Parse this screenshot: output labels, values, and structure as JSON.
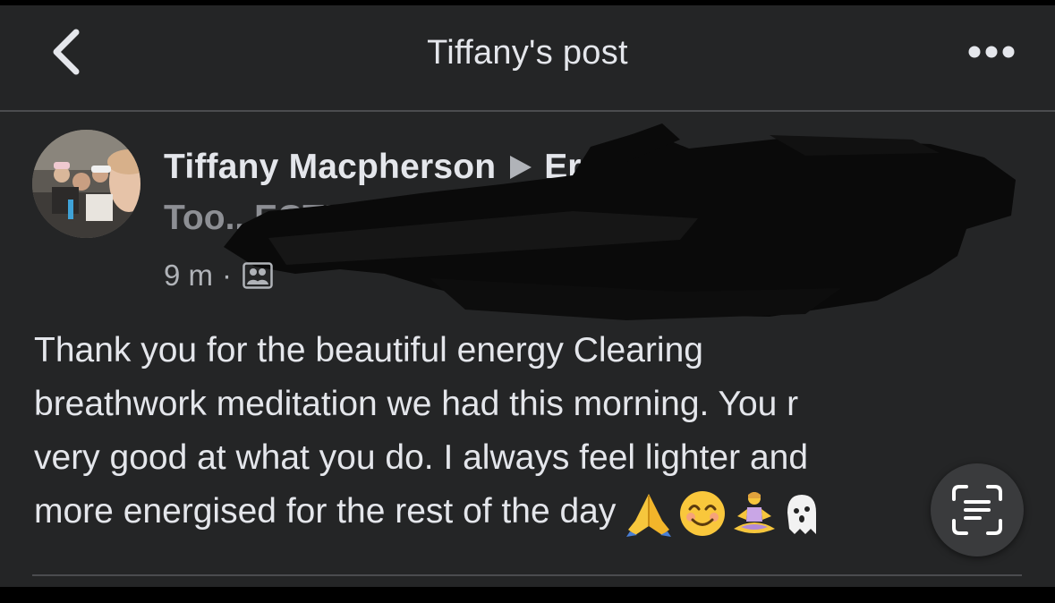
{
  "header": {
    "title": "Tiffany's post",
    "back_icon": "chevron-left-icon",
    "more_icon": "more-horizontal-icon"
  },
  "post": {
    "author_name": "Tiffany Macpherson",
    "group_name_part1": "Er",
    "group_name_part2": "Too...ECTIONS USt...",
    "time": "9 m",
    "separator": "·",
    "audience_icon": "group-audience-icon",
    "lines": [
      "Thank you for the beautiful energy Clearing",
      "breathwork meditation  we had this morning.  You r",
      "very good at what you do.  I always feel lighter and",
      "more energised for the rest of the day"
    ],
    "emojis": [
      "folded-hands-icon",
      "smiling-face-icon",
      "person-in-lotus-position-icon",
      "ghost-icon"
    ]
  },
  "overlay": {
    "live_text_icon": "text-scan-icon"
  },
  "colors": {
    "background": "#242526",
    "text_primary": "#e4e6eb",
    "text_secondary": "#b0b3b8",
    "divider": "#4b4c4f"
  }
}
